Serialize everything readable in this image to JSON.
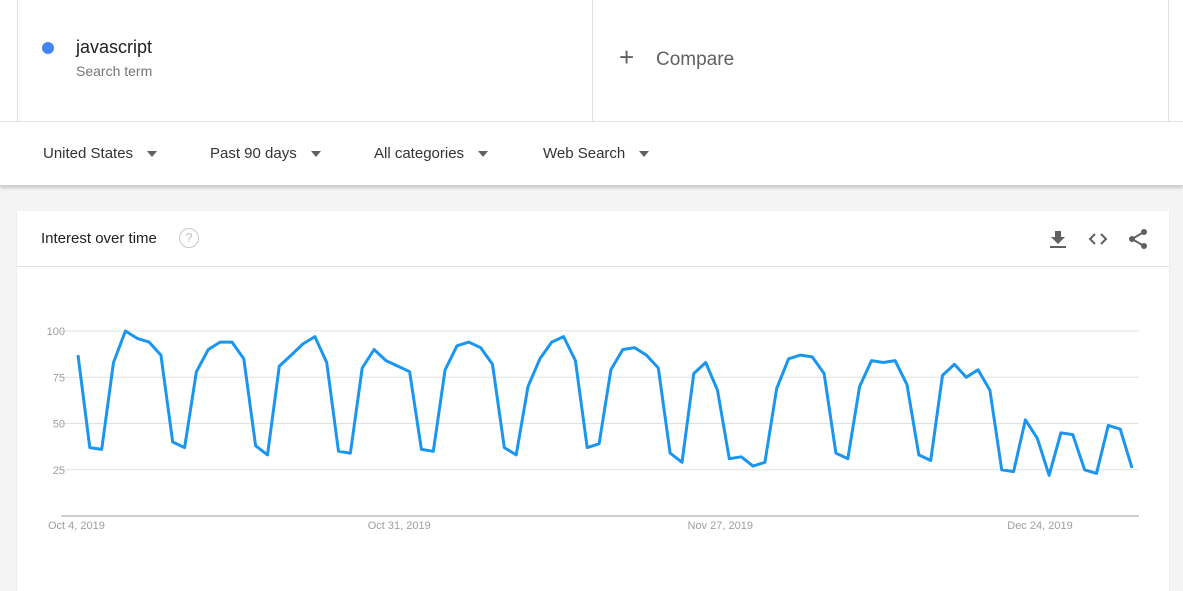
{
  "search_term": {
    "name": "javascript",
    "subtitle": "Search term",
    "color": "#4285f4"
  },
  "compare": {
    "label": "Compare",
    "icon": "plus-icon"
  },
  "filters": {
    "region": "United States",
    "time_range": "Past 90 days",
    "category": "All categories",
    "search_type": "Web Search"
  },
  "panel": {
    "title": "Interest over time",
    "icons": [
      "help-icon",
      "download-icon",
      "embed-icon",
      "share-icon"
    ]
  },
  "chart_data": {
    "type": "line",
    "title": "Interest over time",
    "xlabel": "",
    "ylabel": "",
    "ylim": [
      0,
      100
    ],
    "yticks": [
      25,
      50,
      75,
      100
    ],
    "x_tick_labels": [
      {
        "label": "Oct 4, 2019",
        "index": 0
      },
      {
        "label": "Oct 31, 2019",
        "index": 27
      },
      {
        "label": "Nov 27, 2019",
        "index": 54
      },
      {
        "label": "Dec 24, 2019",
        "index": 81
      }
    ],
    "x_start": "Oct 4, 2019",
    "grid": true,
    "line_color": "#1a96f0",
    "series": [
      {
        "name": "javascript",
        "values": [
          87,
          37,
          36,
          83,
          100,
          96,
          94,
          87,
          40,
          37,
          78,
          90,
          94,
          94,
          85,
          38,
          33,
          81,
          87,
          93,
          97,
          83,
          35,
          34,
          80,
          90,
          84,
          81,
          78,
          36,
          35,
          79,
          92,
          94,
          91,
          82,
          37,
          33,
          70,
          85,
          94,
          97,
          84,
          37,
          39,
          79,
          90,
          91,
          87,
          80,
          34,
          29,
          77,
          83,
          68,
          31,
          32,
          27,
          29,
          69,
          85,
          87,
          86,
          77,
          34,
          31,
          70,
          84,
          83,
          84,
          71,
          33,
          30,
          76,
          82,
          75,
          79,
          68,
          25,
          24,
          52,
          42,
          22,
          45,
          44,
          25,
          23,
          49,
          47,
          26
        ]
      }
    ]
  }
}
